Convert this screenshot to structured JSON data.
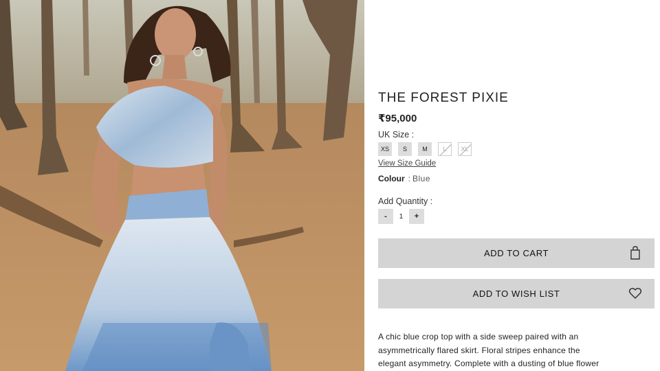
{
  "product": {
    "title": "THE FOREST PIXIE",
    "price": "₹95,000",
    "size_label": "UK Size :",
    "sizes": [
      {
        "label": "XS",
        "available": true
      },
      {
        "label": "S",
        "available": true
      },
      {
        "label": "M",
        "available": true
      },
      {
        "label": "L",
        "available": false
      },
      {
        "label": "XL",
        "available": false
      }
    ],
    "size_guide": "View Size Guide",
    "colour_label": "Colour",
    "colour_separator": ":",
    "colour_value": "Blue",
    "quantity_label": "Add Quantity :",
    "quantity": {
      "minus": "-",
      "value": "1",
      "plus": "+"
    },
    "add_to_cart": "ADD TO CART",
    "add_to_wishlist": "ADD TO WISH LIST",
    "description_lines": [
      "A chic blue crop top with a side sweep paired with an",
      "asymmetrically flared skirt. Floral stripes enhance the",
      "elegant asymmetry. Complete with a dusting of blue flower"
    ]
  },
  "icons": {
    "cart": "shopping-bag-icon",
    "wishlist": "heart-icon"
  },
  "colors": {
    "button_bg": "#d4d4d4",
    "chip_bg": "#dddddd",
    "text": "#222222"
  }
}
